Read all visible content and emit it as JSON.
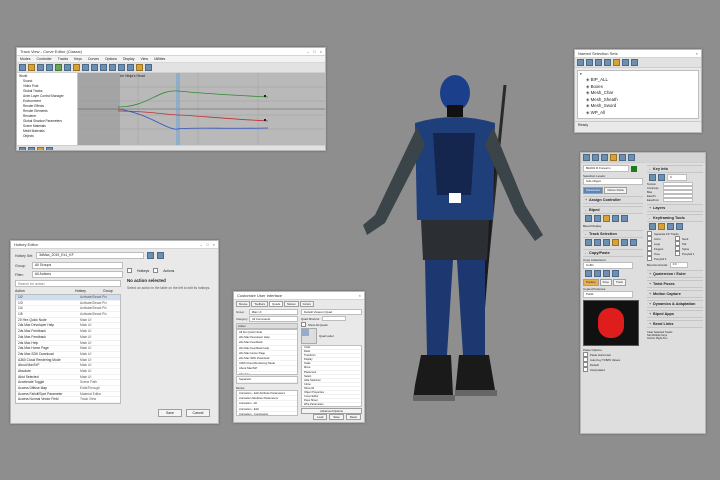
{
  "track_view": {
    "title": "Track View - Curve Editor (Classic)",
    "menus": [
      "Modes",
      "Controller",
      "Tracks",
      "Keys",
      "Curves",
      "Options",
      "Display",
      "View",
      "Utilities"
    ],
    "tracks": [
      "World",
      "Sound",
      "Video Post",
      "Global Tracks",
      "Anim Layer Control Manager",
      "Environment",
      "Render Effects",
      "Render Elements",
      "Renderer",
      "Global Shadow Parameters",
      "Scene Materials",
      "Medit Materials",
      "Objects"
    ],
    "curve_header": "Target Class: Rotation of the Ninja's Head"
  },
  "named_sel": {
    "title": "Named Selection Sets",
    "items": [
      "BIP_ALL",
      "Boxes",
      "Mesh_Char",
      "Mesh_Sheath",
      "Mesh_Sword",
      "WP_All"
    ],
    "status": "Ready"
  },
  "hotkey": {
    "title": "Hotkey Editor",
    "hotkey_set_label": "Hotkey Set:",
    "hotkey_set_value": "3dMax_2019_Ex1_KF",
    "group_label": "Group:",
    "group_value": "All Groups",
    "filter_label": "Filter:",
    "filter_value": "All Actions",
    "search_placeholder": "Search for action",
    "hotkey_col": "Hotkey",
    "action_col": "Action",
    "group_col": "Group",
    "check_hotkey": "Hotkeys",
    "check_actions": "Actions",
    "rows": [
      [
        "1/2",
        "Activate/Deact Pix"
      ],
      [
        "1/3",
        "Activate/Deact Pix"
      ],
      [
        "1/4",
        "Activate/Deact Pix"
      ],
      [
        "1/5",
        "Activate/Deact Pix"
      ],
      [
        "20 Hex Quick Node",
        "Main UI"
      ],
      [
        "2ds Max Developer Help",
        "Main UI"
      ],
      [
        "2ds Max Feedback",
        "Main UI"
      ],
      [
        "2ds Max Feedback",
        "Main UI"
      ],
      [
        "2ds Max Help",
        "Main UI"
      ],
      [
        "2ds Max Home Page",
        "Main UI"
      ],
      [
        "2ds Max SDK Download",
        "Main UI"
      ],
      [
        "A360 Cloud Rendering Mode",
        "Main UI"
      ],
      [
        "About MaxToP",
        "Main UI"
      ],
      [
        "Absolute",
        "Main UI"
      ],
      [
        "Abut Selected",
        "Main UI"
      ],
      [
        "Accelerate Toggle",
        "Scene Path"
      ],
      [
        "Access Diffuse Map",
        "EditaThrough"
      ],
      [
        "Access Falloff/Spot Parameter",
        "Material Editor"
      ],
      [
        "Access Normal Vector Field",
        "Track View"
      ],
      [
        "Access Selected Map Field",
        "Schematic View"
      ],
      [
        "Access Value Field",
        "Schematic View"
      ],
      [
        "Access Time Field",
        "Video Post"
      ]
    ],
    "no_action_title": "No action selected",
    "no_action_hint": "Select an action in the table on the left to edit its hotkeys.",
    "save_label": "Save",
    "cancel_label": "Cancel"
  },
  "cui": {
    "title": "Customize User Interface",
    "tabs": [
      "Mouse",
      "Toolbars",
      "Quads",
      "Menus",
      "Colors"
    ],
    "group_label": "Group:",
    "group_value": "Main UI",
    "category_label": "Category:",
    "category_value": "All Commands",
    "action_col": "Action",
    "actions": [
      "All the Quick Node",
      "2ds Max Developer Help",
      "2ds Max Feedback",
      "2ds Max Feedback Help",
      "2ds Max Home Page",
      "2ds Max SDK Download",
      "A360 Cloud Rendering Mode",
      "About MaxToP",
      "Absolute",
      "Activate Grid Console"
    ],
    "separator_label": "Separator",
    "menus_header": "Menus",
    "menu_items": [
      "Animation - Edit Attribute Parameters",
      "Animation Modules Parameters",
      "Animation - All",
      "Animation - Edit",
      "Animation - Constraints"
    ],
    "quad_value": "Default Viewport Quad",
    "quad_shortcut_label": "Quad Shortcut:",
    "show_all_quads": "Show All Quads",
    "quad_label": "Quad Label",
    "quad_items": [
      "Undo",
      "Redo",
      "Transform",
      "Display",
      "Scale",
      "Move",
      "Placement",
      "Select",
      "Hide Selection",
      "Clone",
      "Show All",
      "Object Properties",
      "Curve Editor",
      "Dope Sheet",
      "Wire Parameters",
      "Convert To:",
      "Properties",
      "V-Ray Scene",
      "V-Ray Properties"
    ],
    "advanced_label": "Advanced Options",
    "load_label": "Load",
    "save_label": "Save",
    "reset_label": "Reset"
  },
  "cmd": {
    "object_name": "Bip001 R Forearm",
    "sel_levels_label": "Selection Levels:",
    "sel_levels_value": "Sub-Object",
    "tabs": [
      "Parameters",
      "Motion Paths"
    ],
    "sections": [
      "Assign Controller",
      "Biped",
      "Track Selection",
      "Copy/Paste",
      "Layers",
      "Keyframing Tools",
      "Quaternion / Euler",
      "Twist Poses",
      "Motion Capture",
      "Dynamics & Adaptation",
      "Biped Apps",
      "Bend Links"
    ],
    "mode_label": "Biped Display",
    "copy_collections_label": "Copy Collections:",
    "collection_value": "Col01",
    "posture_btns": [
      "Posture",
      "Pose",
      "Track"
    ],
    "copied_postures_label": "Copied Postures:",
    "posture_value": "Pst01",
    "paste_options_label": "Paste Options",
    "paste_horizontal": "Paste Horizontal",
    "auto_key_tcb": "Auto Key TCB/IK Values",
    "default_label": "Default",
    "interpolated_label": "Interpolated",
    "key_info": "Key Info",
    "keyframing_tools": "Keyframing Tools",
    "separate_fk": "Separate FK Tracks",
    "fk_tracks": [
      "Arms",
      "Neck",
      "Legs",
      "Tail",
      "Fingers",
      "Spine",
      "Toes",
      "Ponytail 1",
      "Ponytail 2"
    ],
    "bend_label": "Bend Horizontal:",
    "bend_value": "0.0",
    "clear_selected_tracks": "Clear Selected Tracks",
    "set_multiple_keys": "Set Multiple Keys",
    "anchor_right": "Anchor Right Arm",
    "tcb_fields": [
      "Tension",
      "Continuity",
      "Bias",
      "EaseTo",
      "EaseFrom"
    ],
    "frame_value": "0",
    "accent": "#1e7a1e"
  }
}
